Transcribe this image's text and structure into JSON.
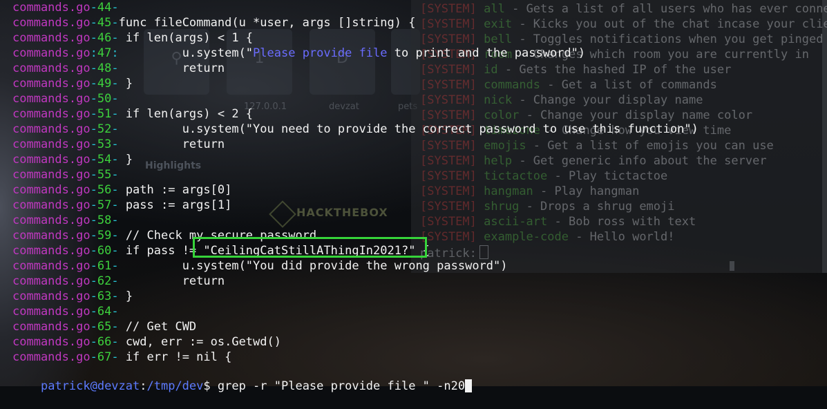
{
  "background": {
    "tiles": [
      {
        "label": "127.0.0.1",
        "glyph": "1"
      },
      {
        "label": "devzat",
        "glyph": "D"
      },
      {
        "label": "pets",
        "glyph": ""
      }
    ],
    "highlights_label": "Highlights",
    "htb_text": "HACKTHEBOX",
    "right_terminal": [
      {
        "tag": "[SYSTEM]",
        "cmd": "all",
        "desc": " - Gets a list of all users who has ever connec"
      },
      {
        "tag": "[SYSTEM]",
        "cmd": "exit",
        "desc": " - Kicks you out of the chat incase your clien"
      },
      {
        "tag": "[SYSTEM]",
        "cmd": "bell",
        "desc": " - Toggles notifications when you get pinged"
      },
      {
        "tag": "[SYSTEM]",
        "cmd": "room",
        "desc": " - Changes which room you are currently in"
      },
      {
        "tag": "[SYSTEM]",
        "cmd": "id",
        "desc": " - Gets the hashed IP of the user"
      },
      {
        "tag": "[SYSTEM]",
        "cmd": "commands",
        "desc": " - Get a list of commands"
      },
      {
        "tag": "[SYSTEM]",
        "cmd": "nick",
        "desc": " - Change your display name"
      },
      {
        "tag": "[SYSTEM]",
        "cmd": "color",
        "desc": " - Change your display name color"
      },
      {
        "tag": "[SYSTEM]",
        "cmd": "timezone",
        "desc": " - Change how you view time"
      },
      {
        "tag": "[SYSTEM]",
        "cmd": "emojis",
        "desc": " - Get a list of emojis you can use"
      },
      {
        "tag": "[SYSTEM]",
        "cmd": "help",
        "desc": " - Get generic info about the server"
      },
      {
        "tag": "[SYSTEM]",
        "cmd": "tictactoe",
        "desc": " - Play tictactoe"
      },
      {
        "tag": "[SYSTEM]",
        "cmd": "hangman",
        "desc": " - Play hangman"
      },
      {
        "tag": "[SYSTEM]",
        "cmd": "shrug",
        "desc": " - Drops a shrug emoji"
      },
      {
        "tag": "[SYSTEM]",
        "cmd": "ascii-art",
        "desc": " - Bob ross with text"
      },
      {
        "tag": "[SYSTEM]",
        "cmd": "example-code",
        "desc": " - Hello world!"
      }
    ],
    "right_prompt": "patrick:"
  },
  "terminal": {
    "lines": [
      {
        "file": "commands.go",
        "sep": "-",
        "num": "44",
        "post": "-",
        "code": ""
      },
      {
        "file": "commands.go",
        "sep": "-",
        "num": "45",
        "post": "-",
        "code": "func fileCommand(u *user, args []string) {"
      },
      {
        "file": "commands.go",
        "sep": "-",
        "num": "46",
        "post": "-",
        "code": "\tif len(args) < 1 {"
      },
      {
        "file": "commands.go",
        "sep": ":",
        "num": "47",
        "post": ":",
        "code_pre": "\t\tu.system(\"",
        "match": "Please provide file ",
        "code_post": "to print and the password\")"
      },
      {
        "file": "commands.go",
        "sep": "-",
        "num": "48",
        "post": "-",
        "code": "\t\treturn"
      },
      {
        "file": "commands.go",
        "sep": "-",
        "num": "49",
        "post": "-",
        "code": "\t}"
      },
      {
        "file": "commands.go",
        "sep": "-",
        "num": "50",
        "post": "-",
        "code": ""
      },
      {
        "file": "commands.go",
        "sep": "-",
        "num": "51",
        "post": "-",
        "code": "\tif len(args) < 2 {"
      },
      {
        "file": "commands.go",
        "sep": "-",
        "num": "52",
        "post": "-",
        "code": "\t\tu.system(\"You need to provide the correct password to use this function\")"
      },
      {
        "file": "commands.go",
        "sep": "-",
        "num": "53",
        "post": "-",
        "code": "\t\treturn"
      },
      {
        "file": "commands.go",
        "sep": "-",
        "num": "54",
        "post": "-",
        "code": "\t}"
      },
      {
        "file": "commands.go",
        "sep": "-",
        "num": "55",
        "post": "-",
        "code": ""
      },
      {
        "file": "commands.go",
        "sep": "-",
        "num": "56",
        "post": "-",
        "code": "\tpath := args[0]"
      },
      {
        "file": "commands.go",
        "sep": "-",
        "num": "57",
        "post": "-",
        "code": "\tpass := args[1]"
      },
      {
        "file": "commands.go",
        "sep": "-",
        "num": "58",
        "post": "-",
        "code": ""
      },
      {
        "file": "commands.go",
        "sep": "-",
        "num": "59",
        "post": "-",
        "code": "\t// Check my secure password"
      },
      {
        "file": "commands.go",
        "sep": "-",
        "num": "60",
        "post": "-",
        "code": "\tif pass != \"CeilingCatStillAThingIn2021?\" {"
      },
      {
        "file": "commands.go",
        "sep": "-",
        "num": "61",
        "post": "-",
        "code": "\t\tu.system(\"You did provide the wrong password\")"
      },
      {
        "file": "commands.go",
        "sep": "-",
        "num": "62",
        "post": "-",
        "code": "\t\treturn"
      },
      {
        "file": "commands.go",
        "sep": "-",
        "num": "63",
        "post": "-",
        "code": "\t}"
      },
      {
        "file": "commands.go",
        "sep": "-",
        "num": "64",
        "post": "-",
        "code": ""
      },
      {
        "file": "commands.go",
        "sep": "-",
        "num": "65",
        "post": "-",
        "code": "\t// Get CWD"
      },
      {
        "file": "commands.go",
        "sep": "-",
        "num": "66",
        "post": "-",
        "code": "\tcwd, err := os.Getwd()"
      },
      {
        "file": "commands.go",
        "sep": "-",
        "num": "67",
        "post": "-",
        "code": "\tif err != nil {"
      }
    ],
    "prompt": {
      "user_host": "patrick@devzat",
      "colon": ":",
      "path": "/tmp/dev",
      "symbol": "$ ",
      "command": "grep -r \"Please provide file \" -n20"
    }
  }
}
